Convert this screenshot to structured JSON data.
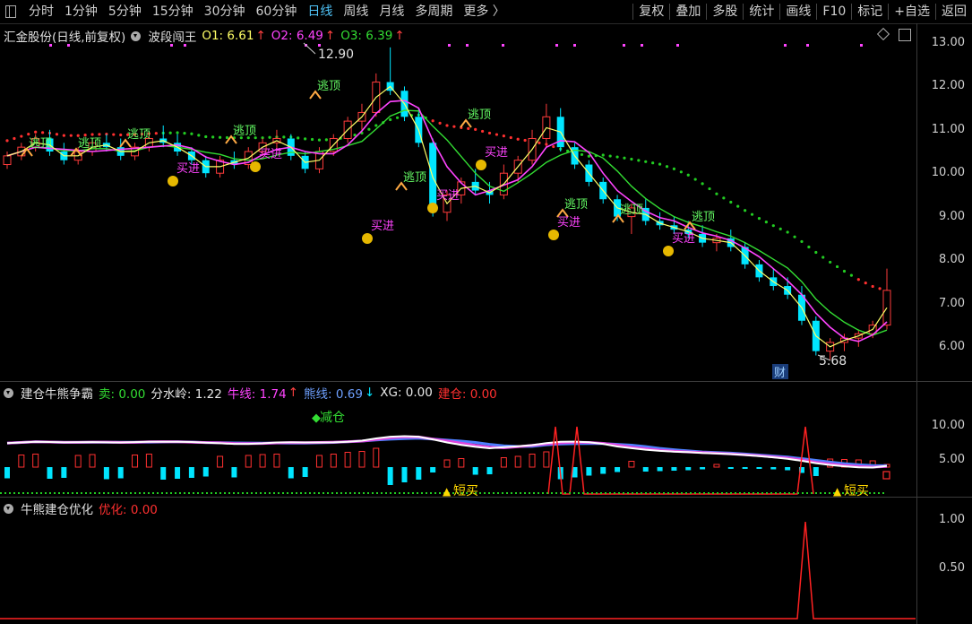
{
  "toolbar": {
    "left_items": [
      "分时",
      "1分钟",
      "5分钟",
      "15分钟",
      "30分钟",
      "60分钟",
      "日线",
      "周线",
      "月线",
      "多周期",
      "更多 〉"
    ],
    "active": "日线",
    "right_items": [
      "复权",
      "叠加",
      "多股",
      "统计",
      "画线",
      "F10",
      "标记",
      "+自选",
      "返回"
    ]
  },
  "main_pane": {
    "stock_name": "汇金股份(日线,前复权)",
    "indicator_name": "波段闯王",
    "o1_label": "O1: 6.61",
    "o2_label": "O2: 6.49",
    "o3_label": "O3: 6.39",
    "high_label": "12.90",
    "low_label": "5.68",
    "cai_label": "财",
    "y_ticks": [
      "13.00",
      "12.00",
      "11.00",
      "10.00",
      "9.00",
      "8.00",
      "7.00",
      "6.00"
    ],
    "signal_top": "逃顶",
    "signal_buy": "买进"
  },
  "sub_pane1": {
    "name": "建仓牛熊争霸",
    "sell_label": "卖: 0.00",
    "fsl_label": "分水岭: 1.22",
    "niu_label": "牛线: 1.74",
    "xiong_label": "熊线: 0.69",
    "xg_label": "XG: 0.00",
    "jc_label": "建仓: 0.00",
    "jiancang_text": "减仓",
    "duanmai_text": "短买",
    "y_ticks": [
      "10.00",
      "5.00"
    ]
  },
  "sub_pane2": {
    "name": "牛熊建仓优化",
    "youhua_label": "优化: 0.00",
    "y_ticks": [
      "1.00",
      "0.50"
    ]
  },
  "colors": {
    "up": "#ff3b3b",
    "down": "#00e5ff",
    "ma_yellow": "#ffff66",
    "ma_magenta": "#ff44ff",
    "ma_green": "#33dd33",
    "dot_red": "#ff3030",
    "dot_green": "#22cc22",
    "accent": "#4fc3f7"
  },
  "chart_data": {
    "type": "candlestick",
    "price_range": [
      5.5,
      13.0
    ],
    "candles": [
      [
        10.2,
        10.5,
        10.1,
        10.4
      ],
      [
        10.4,
        10.7,
        10.3,
        10.6
      ],
      [
        10.6,
        10.9,
        10.5,
        10.8
      ],
      [
        10.8,
        11.0,
        10.4,
        10.5
      ],
      [
        10.5,
        10.7,
        10.2,
        10.3
      ],
      [
        10.3,
        10.6,
        10.2,
        10.5
      ],
      [
        10.5,
        10.8,
        10.4,
        10.7
      ],
      [
        10.7,
        10.9,
        10.5,
        10.6
      ],
      [
        10.6,
        10.8,
        10.3,
        10.4
      ],
      [
        10.4,
        10.7,
        10.3,
        10.6
      ],
      [
        10.6,
        10.9,
        10.5,
        10.8
      ],
      [
        10.8,
        11.1,
        10.6,
        10.7
      ],
      [
        10.7,
        10.9,
        10.4,
        10.5
      ],
      [
        10.5,
        10.6,
        10.2,
        10.3
      ],
      [
        10.3,
        10.4,
        9.9,
        10.0
      ],
      [
        10.0,
        10.4,
        9.9,
        10.3
      ],
      [
        10.3,
        10.5,
        10.1,
        10.2
      ],
      [
        10.2,
        10.6,
        10.1,
        10.5
      ],
      [
        10.5,
        10.8,
        10.4,
        10.7
      ],
      [
        10.7,
        11.0,
        10.5,
        10.8
      ],
      [
        10.8,
        10.9,
        10.3,
        10.4
      ],
      [
        10.4,
        10.5,
        10.0,
        10.1
      ],
      [
        10.1,
        10.6,
        10.0,
        10.5
      ],
      [
        10.5,
        10.9,
        10.4,
        10.8
      ],
      [
        10.8,
        11.3,
        10.7,
        11.2
      ],
      [
        11.2,
        11.6,
        11.0,
        11.4
      ],
      [
        11.4,
        12.3,
        11.3,
        12.1
      ],
      [
        12.1,
        12.9,
        11.8,
        11.9
      ],
      [
        11.9,
        12.0,
        11.2,
        11.3
      ],
      [
        11.3,
        11.5,
        10.6,
        10.7
      ],
      [
        10.7,
        10.8,
        9.0,
        9.1
      ],
      [
        9.1,
        9.6,
        8.9,
        9.5
      ],
      [
        9.5,
        9.9,
        9.3,
        9.8
      ],
      [
        9.8,
        10.1,
        9.5,
        9.6
      ],
      [
        9.6,
        9.8,
        9.3,
        9.5
      ],
      [
        9.5,
        10.2,
        9.4,
        10.0
      ],
      [
        10.0,
        10.4,
        9.8,
        10.3
      ],
      [
        10.3,
        11.0,
        10.2,
        10.8
      ],
      [
        10.8,
        11.6,
        10.6,
        11.3
      ],
      [
        11.3,
        11.5,
        10.5,
        10.6
      ],
      [
        10.6,
        10.7,
        10.1,
        10.2
      ],
      [
        10.2,
        10.3,
        9.7,
        9.8
      ],
      [
        9.8,
        9.9,
        9.3,
        9.4
      ],
      [
        9.4,
        9.5,
        8.9,
        9.0
      ],
      [
        9.0,
        9.3,
        8.6,
        9.2
      ],
      [
        9.2,
        9.4,
        8.8,
        8.9
      ],
      [
        8.9,
        9.1,
        8.7,
        8.8
      ],
      [
        8.8,
        9.0,
        8.6,
        8.7
      ],
      [
        8.7,
        8.9,
        8.5,
        8.6
      ],
      [
        8.6,
        8.8,
        8.3,
        8.4
      ],
      [
        8.4,
        8.6,
        8.2,
        8.5
      ],
      [
        8.5,
        8.7,
        8.2,
        8.3
      ],
      [
        8.3,
        8.4,
        7.8,
        7.9
      ],
      [
        7.9,
        8.0,
        7.5,
        7.6
      ],
      [
        7.6,
        7.8,
        7.3,
        7.4
      ],
      [
        7.4,
        7.6,
        7.1,
        7.2
      ],
      [
        7.2,
        7.4,
        6.5,
        6.6
      ],
      [
        6.6,
        6.7,
        5.8,
        5.9
      ],
      [
        5.9,
        6.2,
        5.7,
        6.1
      ],
      [
        6.1,
        6.3,
        5.9,
        6.2
      ],
      [
        6.2,
        6.4,
        6.0,
        6.3
      ],
      [
        6.3,
        6.6,
        6.2,
        6.5
      ],
      [
        6.5,
        7.8,
        6.4,
        7.3
      ]
    ]
  }
}
